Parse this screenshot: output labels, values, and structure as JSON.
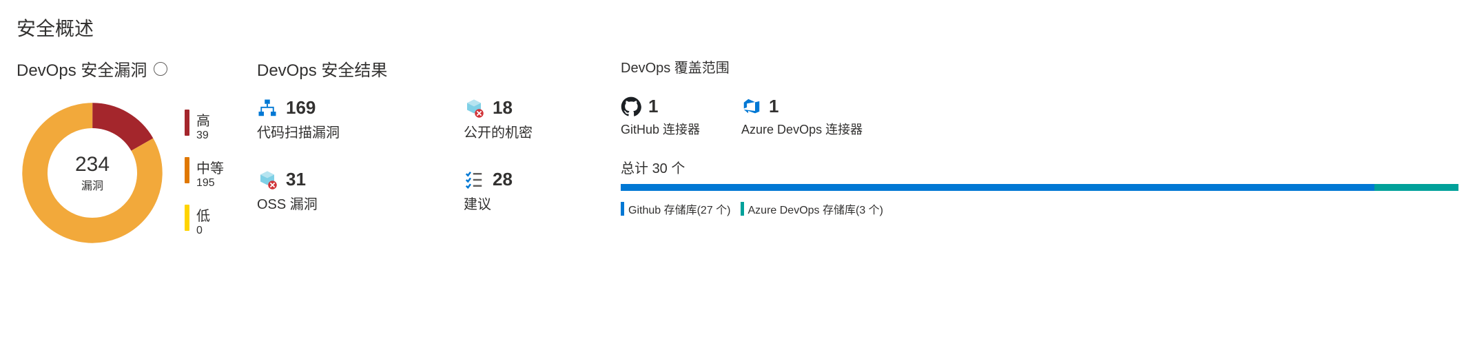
{
  "title": "安全概述",
  "colors": {
    "high": "#a4262c",
    "medium": "#e07800",
    "low": "#ffd400",
    "donut_main": "#f2a93b",
    "blue": "#0078d4",
    "teal": "#00a19a"
  },
  "vulnerabilities": {
    "title": "DevOps 安全漏洞",
    "total": "234",
    "total_label": "漏洞",
    "severities": [
      {
        "name": "高",
        "count": "39"
      },
      {
        "name": "中等",
        "count": "195"
      },
      {
        "name": "低",
        "count": "0"
      }
    ]
  },
  "results": {
    "title": "DevOps 安全结果",
    "items": [
      {
        "icon": "sitemap",
        "value": "169",
        "label": "代码扫描漏洞"
      },
      {
        "icon": "cube-alert",
        "value": "18",
        "label": "公开的机密"
      },
      {
        "icon": "cube-alert",
        "value": "31",
        "label": "OSS 漏洞"
      },
      {
        "icon": "checklist",
        "value": "28",
        "label": "建议"
      }
    ]
  },
  "coverage": {
    "title": "DevOps 覆盖范围",
    "connectors": [
      {
        "icon": "github",
        "value": "1",
        "label": "GitHub 连接器"
      },
      {
        "icon": "azure-devops",
        "value": "1",
        "label": "Azure DevOps 连接器"
      }
    ],
    "total_label": "总计",
    "total_value": "30 个",
    "repos": [
      {
        "label": "Github 存储库(27 个)",
        "value": 27
      },
      {
        "label": "Azure DevOps 存储库(3 个)",
        "value": 3
      }
    ]
  },
  "chart_data": [
    {
      "type": "pie",
      "title": "DevOps 安全漏洞",
      "categories": [
        "高",
        "中等",
        "低"
      ],
      "values": [
        39,
        195,
        0
      ],
      "total": 234,
      "colors": [
        "#a4262c",
        "#f2a93b",
        "#ffd400"
      ]
    },
    {
      "type": "bar",
      "title": "DevOps 覆盖范围 (存储库)",
      "categories": [
        "Github 存储库",
        "Azure DevOps 存储库"
      ],
      "values": [
        27,
        3
      ],
      "total": 30,
      "colors": [
        "#0078d4",
        "#00a19a"
      ]
    }
  ]
}
